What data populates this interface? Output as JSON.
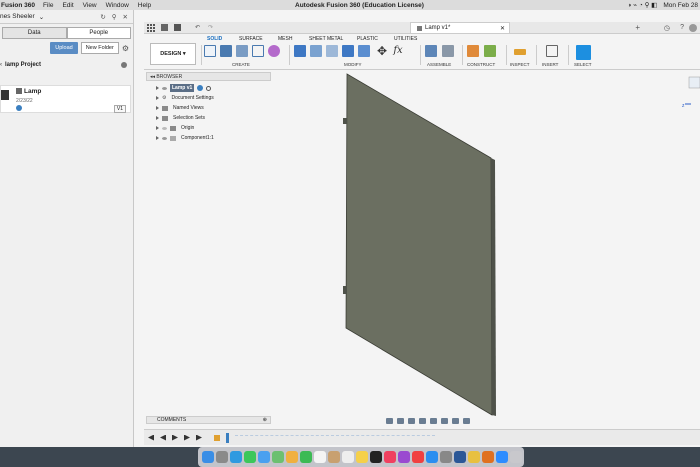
{
  "menubar": {
    "app_name": "Fusion 360",
    "items": [
      "File",
      "Edit",
      "View",
      "Window",
      "Help"
    ],
    "window_title": "Autodesk Fusion 360 (Education License)",
    "clock": "Mon Feb 28"
  },
  "data_panel": {
    "user": "nes Sheeler",
    "tabs": [
      "Data",
      "People"
    ],
    "upload_label": "Upload",
    "new_folder_label": "New Folder",
    "project_name": "lamp Project",
    "item": {
      "name": "Lamp",
      "date": "2/23/22",
      "version": "V1"
    }
  },
  "app": {
    "doc_tab_title": "Lamp v1*",
    "ribbon_tabs": [
      "SOLID",
      "SURFACE",
      "MESH",
      "SHEET METAL",
      "PLASTIC",
      "UTILITIES"
    ],
    "active_tab": "SOLID",
    "design_label": "DESIGN",
    "groups": [
      "CREATE",
      "MODIFY",
      "ASSEMBLE",
      "CONSTRUCT",
      "INSPECT",
      "INSERT",
      "SELECT"
    ],
    "fx_label": "fx"
  },
  "browser": {
    "title": "BROWSER",
    "root": "Lamp v1",
    "nodes": [
      "Document Settings",
      "Named Views",
      "Selection Sets",
      "Origin",
      "Component1:1"
    ]
  },
  "comments_label": "COMMENTS",
  "colors": {
    "accent": "#1a6fc0",
    "part_fill": "#6b6f61",
    "viewport_bg": "#ffffff",
    "select_tool": "#1d8fe0"
  }
}
